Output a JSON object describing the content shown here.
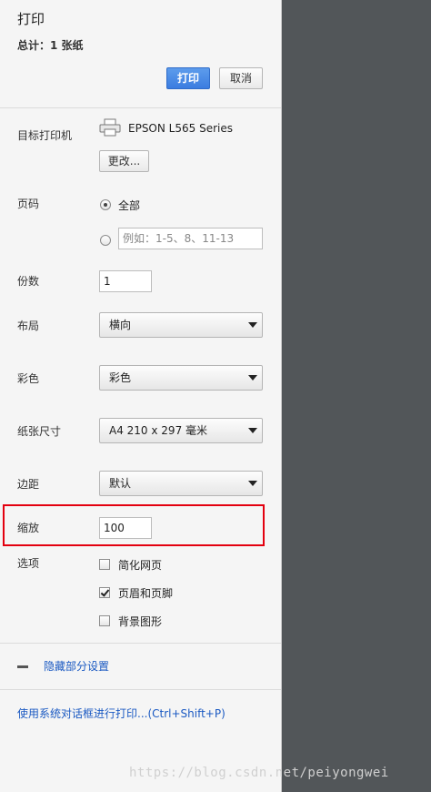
{
  "header": {
    "title": "打印",
    "summary": "总计：1 张纸",
    "print_button": "打印",
    "cancel_button": "取消"
  },
  "destination": {
    "label": "目标打印机",
    "printer_name": "EPSON L565 Series",
    "change_button": "更改..."
  },
  "pages": {
    "label": "页码",
    "all_label": "全部",
    "custom_placeholder": "例如：1-5、8、11-13"
  },
  "copies": {
    "label": "份数",
    "value": "1"
  },
  "layout": {
    "label": "布局",
    "value": "横向"
  },
  "color": {
    "label": "彩色",
    "value": "彩色"
  },
  "paper_size": {
    "label": "纸张尺寸",
    "value": "A4 210 x 297 毫米"
  },
  "margins": {
    "label": "边距",
    "value": "默认"
  },
  "scale": {
    "label": "缩放",
    "value": "100"
  },
  "options": {
    "label": "选项",
    "items": [
      {
        "label": "简化网页",
        "checked": false
      },
      {
        "label": "页眉和页脚",
        "checked": true
      },
      {
        "label": "背景图形",
        "checked": false
      }
    ]
  },
  "fewer_settings": "隐藏部分设置",
  "system_dialog_link": "使用系统对话框进行打印...(Ctrl+Shift+P)",
  "watermark": "https://blog.csdn.net/peiyongwei",
  "colors": {
    "accent": "#3b7de0",
    "highlight": "#e3000f",
    "link": "#1a59c2"
  }
}
